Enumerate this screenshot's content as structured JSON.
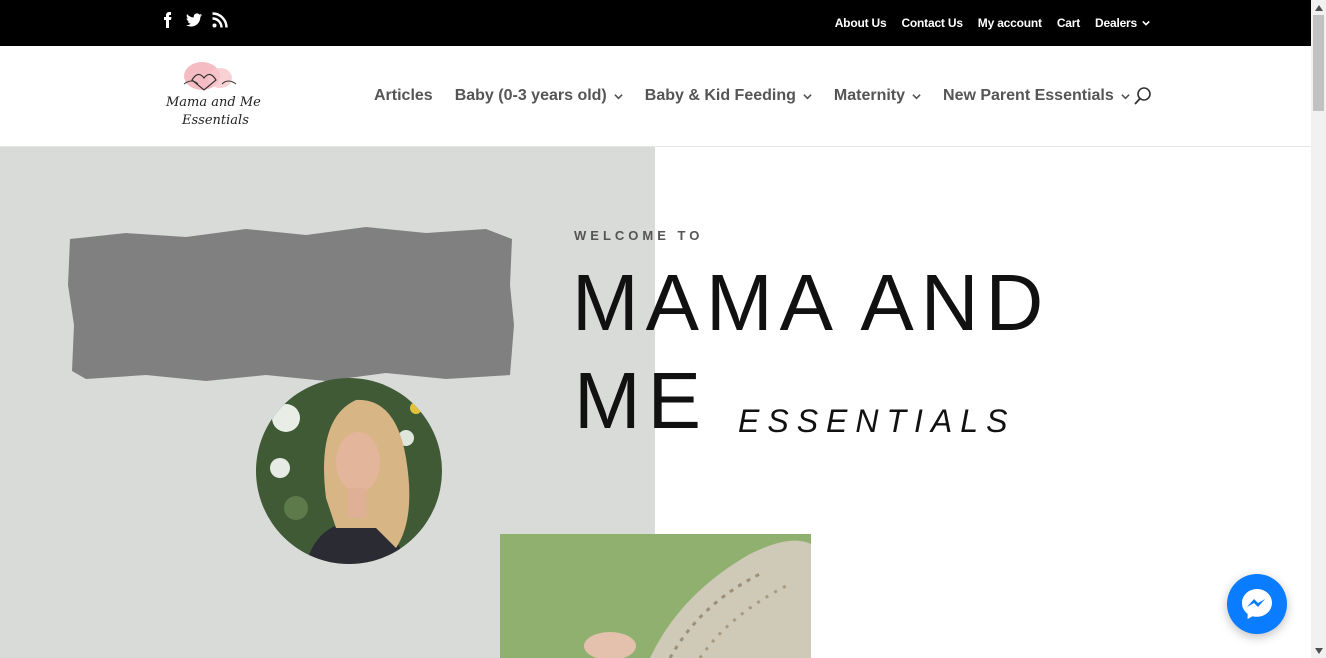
{
  "topbar": {
    "social_icons": [
      "facebook-icon",
      "twitter-icon",
      "rss-icon"
    ],
    "links": [
      "About Us",
      "Contact Us",
      "My account",
      "Cart",
      "Dealers"
    ]
  },
  "header": {
    "logo_text_line1": "Mama and Me",
    "logo_text_line2": "Essentials",
    "nav": {
      "articles": "Articles",
      "baby": "Baby (0-3 years old)",
      "feeding": "Baby & Kid Feeding",
      "maternity": "Maternity",
      "parent": "New Parent Essentials"
    },
    "search_icon": "search-icon"
  },
  "hero": {
    "welcome": "WELCOME TO",
    "title_line1": "MAMA AND",
    "title_line2": "ME",
    "title_script": "ESSENTIALS"
  },
  "colors": {
    "topbar_bg": "#000000",
    "hero_left_bg": "#d9dbd8",
    "brush": "#808080",
    "messenger": "#0a7cff"
  }
}
